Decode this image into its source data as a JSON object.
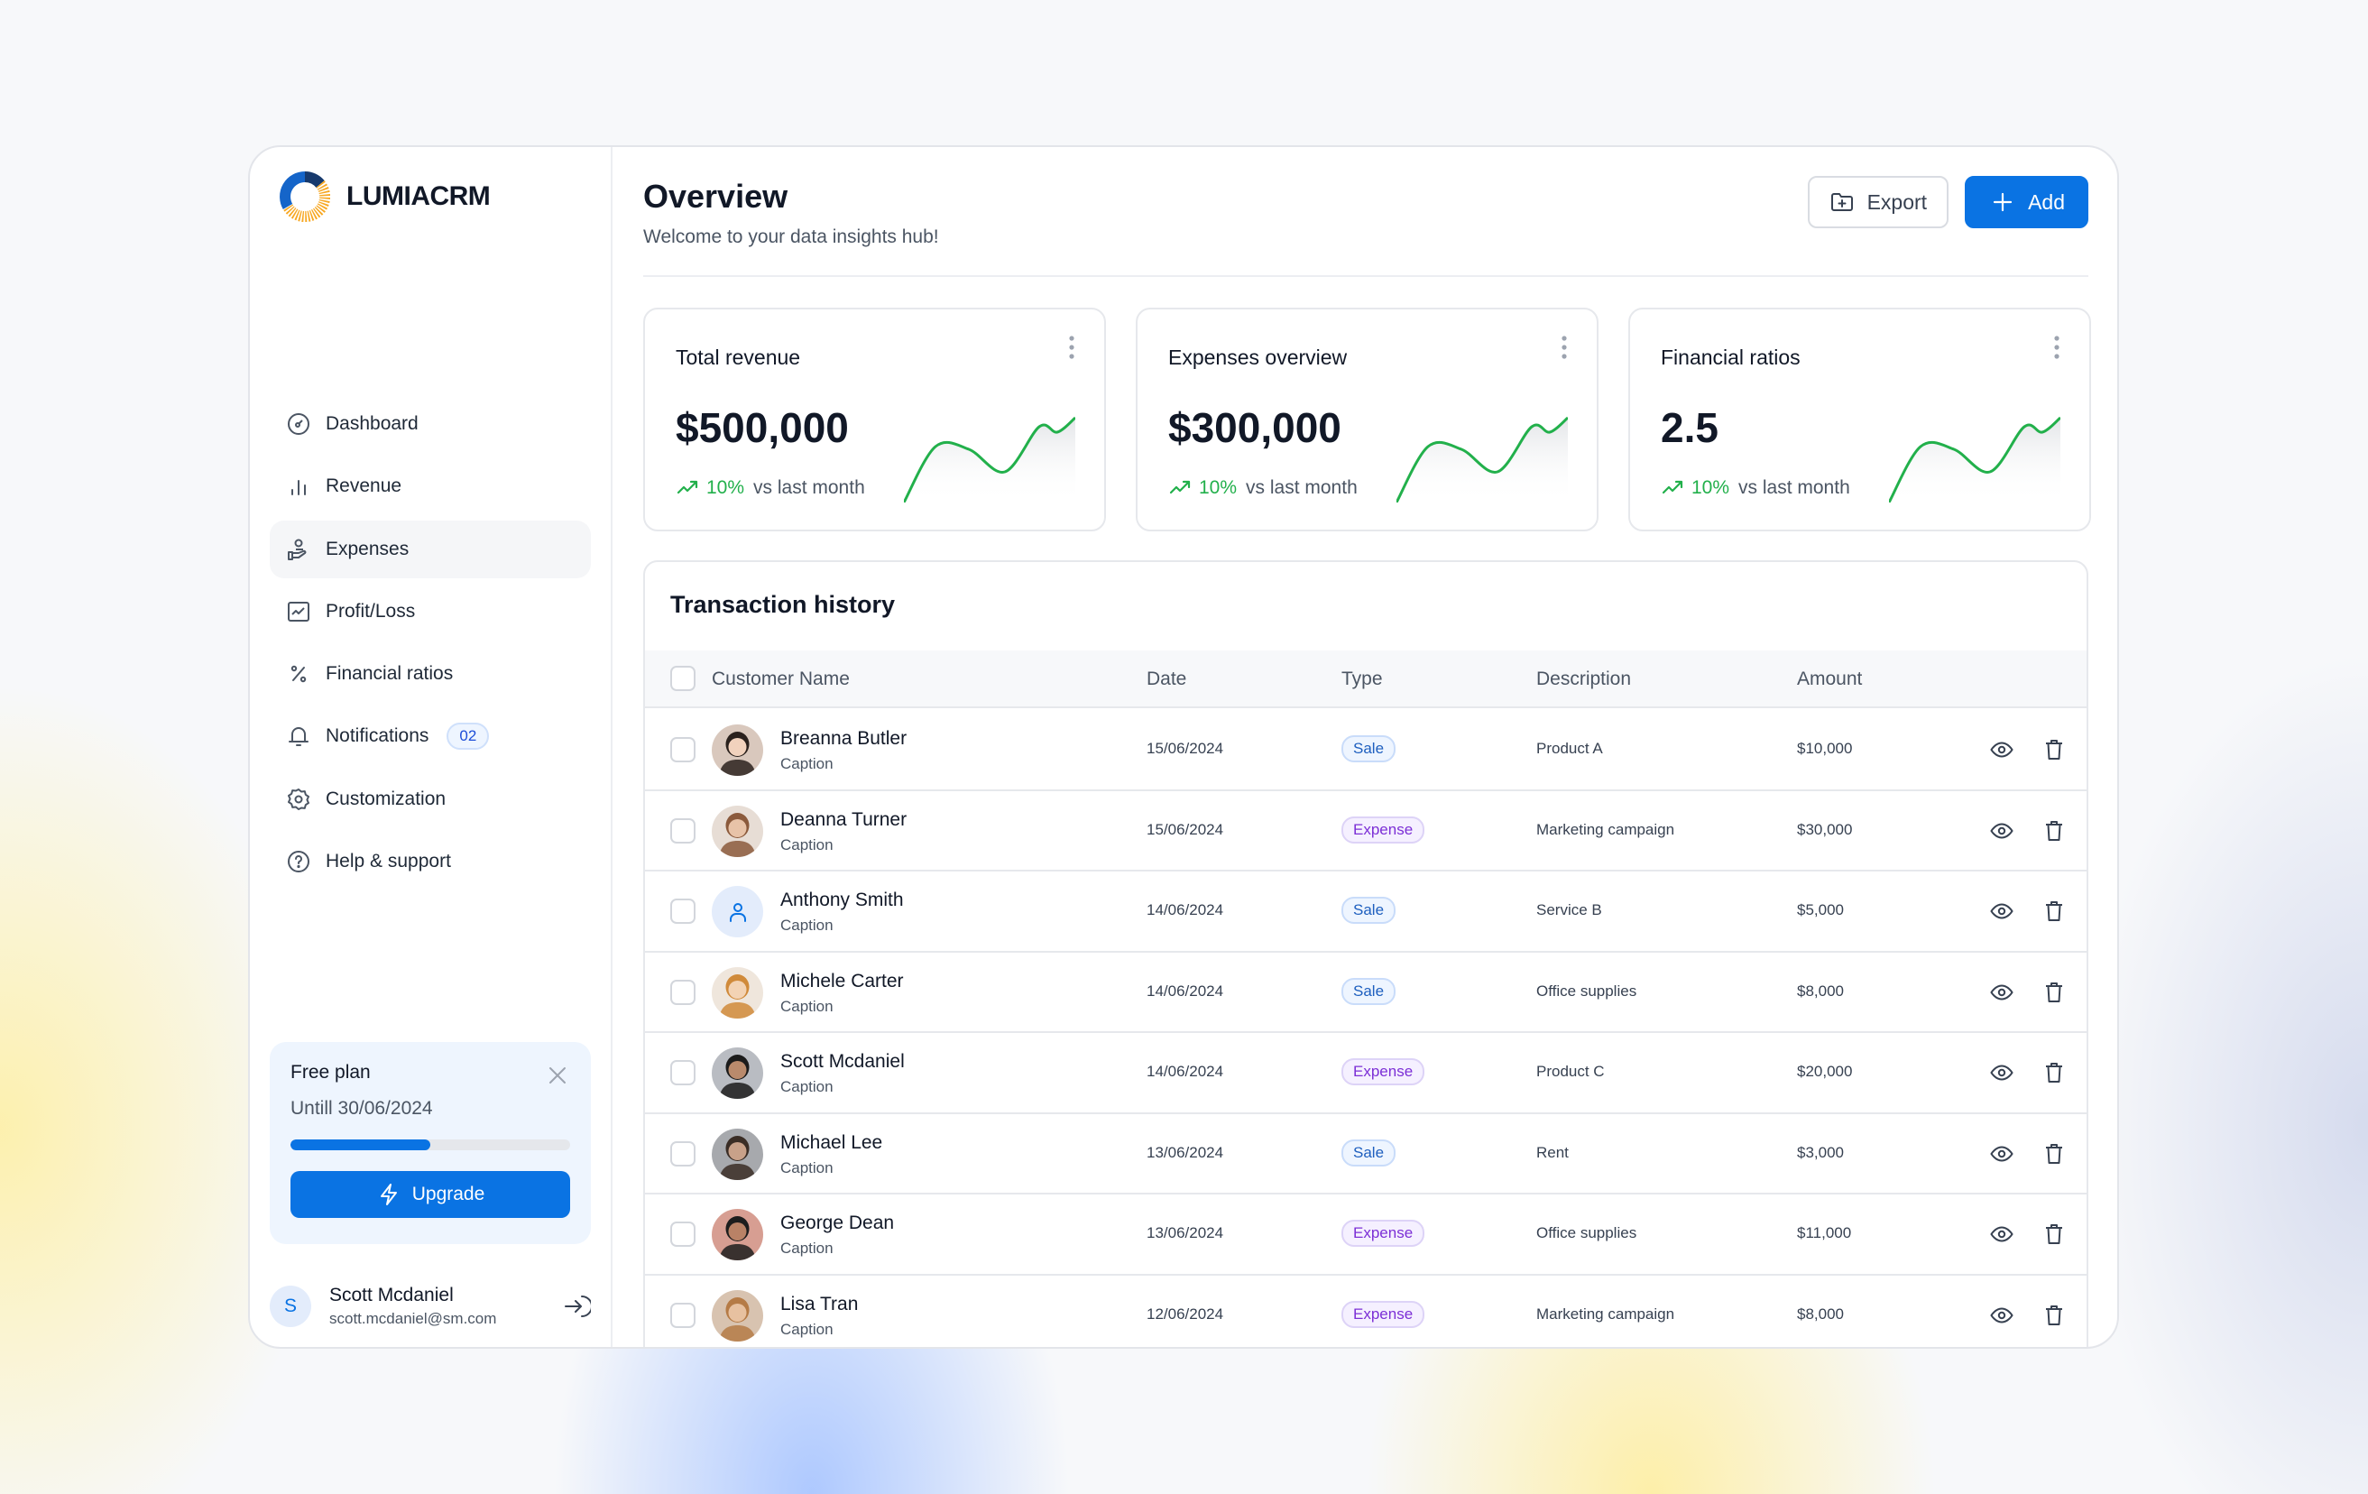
{
  "brand": {
    "name": "LUMIACRM"
  },
  "sidebar": {
    "items": [
      {
        "label": "Dashboard",
        "icon": "dashboard-icon",
        "active": false
      },
      {
        "label": "Revenue",
        "icon": "bar-chart-icon",
        "active": false
      },
      {
        "label": "Expenses",
        "icon": "hand-coins-icon",
        "active": true
      },
      {
        "label": "Profit/Loss",
        "icon": "line-chart-icon",
        "active": false
      },
      {
        "label": "Financial ratios",
        "icon": "percent-icon",
        "active": false
      },
      {
        "label": "Notifications",
        "icon": "bell-icon",
        "active": false,
        "badge": "02"
      },
      {
        "label": "Customization",
        "icon": "gear-icon",
        "active": false
      },
      {
        "label": "Help & support",
        "icon": "help-icon",
        "active": false
      }
    ],
    "plan": {
      "title": "Free plan",
      "until": "Untill 30/06/2024",
      "progress_percent": 50,
      "upgrade_label": "Upgrade"
    },
    "user": {
      "initial": "S",
      "name": "Scott Mcdaniel",
      "email": "scott.mcdaniel@sm.com"
    }
  },
  "header": {
    "title": "Overview",
    "subtitle": "Welcome to your data insights hub!",
    "export_label": "Export",
    "add_label": "Add"
  },
  "stats": [
    {
      "title": "Total revenue",
      "value": "$500,000",
      "trend": "10%",
      "trend_label": "vs last month"
    },
    {
      "title": "Expenses overview",
      "value": "$300,000",
      "trend": "10%",
      "trend_label": "vs last month"
    },
    {
      "title": "Financial ratios",
      "value": "2.5",
      "trend": "10%",
      "trend_label": "vs last month"
    }
  ],
  "colors": {
    "primary": "#0a73e3",
    "trend_up": "#22b04b",
    "sale": "#1e5fbf",
    "expense": "#7c2fd6"
  },
  "transactions": {
    "title": "Transaction history",
    "columns": [
      "Customer Name",
      "Date",
      "Type",
      "Description",
      "Amount"
    ],
    "rows": [
      {
        "name": "Breanna Butler",
        "caption": "Caption",
        "date": "15/06/2024",
        "type": "Sale",
        "description": "Product A",
        "amount": "$10,000",
        "avatar": "photo"
      },
      {
        "name": "Deanna Turner",
        "caption": "Caption",
        "date": "15/06/2024",
        "type": "Expense",
        "description": "Marketing campaign",
        "amount": "$30,000",
        "avatar": "photo"
      },
      {
        "name": "Anthony Smith",
        "caption": "Caption",
        "date": "14/06/2024",
        "type": "Sale",
        "description": "Service B",
        "amount": "$5,000",
        "avatar": "placeholder"
      },
      {
        "name": "Michele Carter",
        "caption": "Caption",
        "date": "14/06/2024",
        "type": "Sale",
        "description": "Office supplies",
        "amount": "$8,000",
        "avatar": "photo"
      },
      {
        "name": "Scott Mcdaniel",
        "caption": "Caption",
        "date": "14/06/2024",
        "type": "Expense",
        "description": "Product C",
        "amount": "$20,000",
        "avatar": "photo"
      },
      {
        "name": "Michael Lee",
        "caption": "Caption",
        "date": "13/06/2024",
        "type": "Sale",
        "description": "Rent",
        "amount": "$3,000",
        "avatar": "photo"
      },
      {
        "name": "George Dean",
        "caption": "Caption",
        "date": "13/06/2024",
        "type": "Expense",
        "description": "Office supplies",
        "amount": "$11,000",
        "avatar": "photo"
      },
      {
        "name": "Lisa Tran",
        "caption": "Caption",
        "date": "12/06/2024",
        "type": "Expense",
        "description": "Marketing campaign",
        "amount": "$8,000",
        "avatar": "photo"
      }
    ]
  }
}
